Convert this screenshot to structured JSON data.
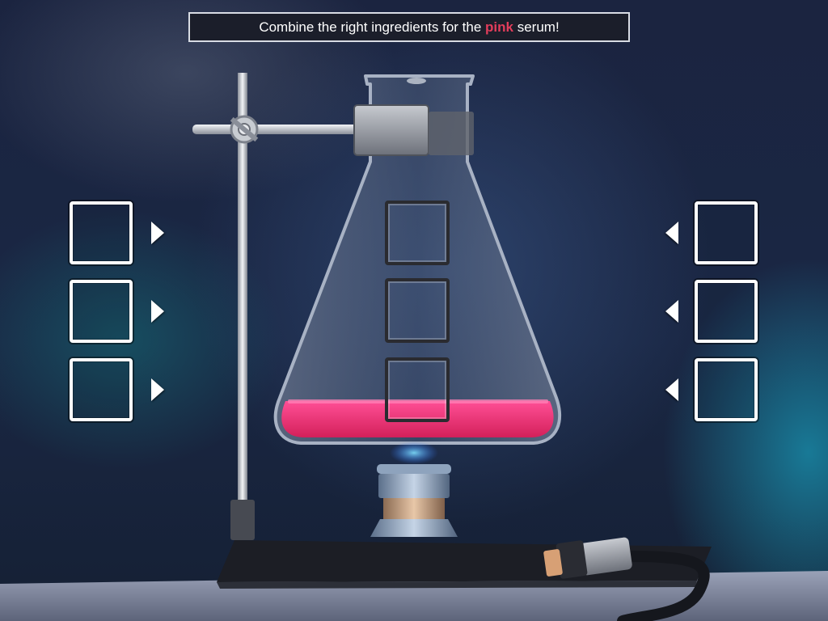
{
  "instruction": {
    "prefix": "Combine the right ingredients for the ",
    "highlight": "pink",
    "suffix": " serum!"
  },
  "serum": {
    "color_name": "pink",
    "liquid_color": "#e8326e",
    "highlight_color": "#e23d5b"
  },
  "left_slots": [
    {
      "id": "left-1"
    },
    {
      "id": "left-2"
    },
    {
      "id": "left-3"
    }
  ],
  "right_slots": [
    {
      "id": "right-1"
    },
    {
      "id": "right-2"
    },
    {
      "id": "right-3"
    }
  ],
  "flask_slots": [
    {
      "id": "flask-1"
    },
    {
      "id": "flask-2"
    },
    {
      "id": "flask-3"
    }
  ],
  "icons": {
    "left_arrow": "triangle-right-icon",
    "right_arrow": "triangle-left-icon"
  }
}
